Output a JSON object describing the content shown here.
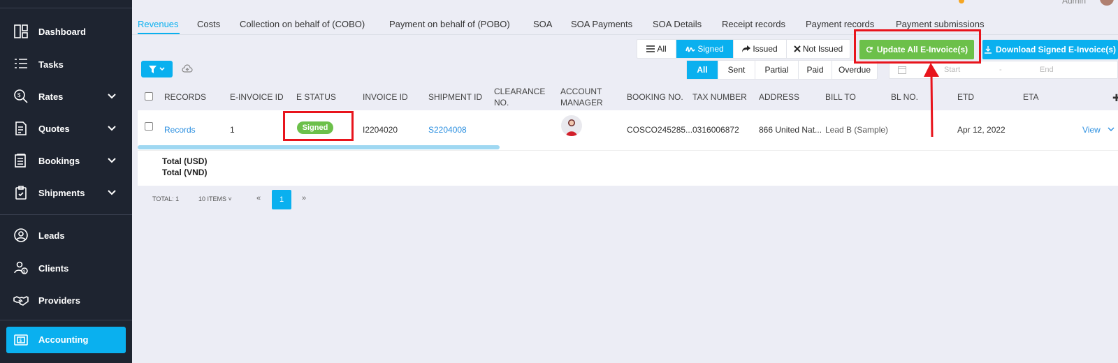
{
  "header": {
    "admin_label": "Admin"
  },
  "sidebar": {
    "items": [
      {
        "label": "Dashboard",
        "icon": "dashboard-icon"
      },
      {
        "label": "Tasks",
        "icon": "tasks-icon"
      },
      {
        "label": "Rates",
        "icon": "rates-icon"
      },
      {
        "label": "Quotes",
        "icon": "quotes-icon"
      },
      {
        "label": "Bookings",
        "icon": "bookings-icon"
      },
      {
        "label": "Shipments",
        "icon": "shipments-icon"
      },
      {
        "label": "Leads",
        "icon": "leads-icon"
      },
      {
        "label": "Clients",
        "icon": "clients-icon"
      },
      {
        "label": "Providers",
        "icon": "providers-icon"
      },
      {
        "label": "Accounting",
        "icon": "accounting-icon"
      }
    ]
  },
  "tabs": [
    "Revenues",
    "Costs",
    "Collection on behalf of (COBO)",
    "Payment on behalf of (POBO)",
    "SOA",
    "SOA Payments",
    "SOA Details",
    "Receipt records",
    "Payment records",
    "Payment submissions"
  ],
  "einvoice_filter": {
    "options": [
      {
        "label": "All",
        "icon": "list-icon"
      },
      {
        "label": "Signed",
        "icon": "signature-icon"
      },
      {
        "label": "Issued",
        "icon": "share-icon"
      },
      {
        "label": "Not Issued",
        "icon": "x-icon"
      }
    ],
    "selected": "Signed"
  },
  "actions": {
    "update_label": "Update All E-Invoice(s)",
    "download_label": "Download Signed E-Invoice(s)"
  },
  "status_filter": {
    "options": [
      "All",
      "Sent",
      "Partial",
      "Paid",
      "Overdue"
    ],
    "selected": "All"
  },
  "date_range": {
    "start_placeholder": "Start",
    "separator": "-",
    "end_placeholder": "End"
  },
  "table": {
    "headers": {
      "records": "RECORDS",
      "einvoice_id": "E-INVOICE ID",
      "e_status": "E STATUS",
      "invoice_id": "INVOICE ID",
      "shipment_id": "SHIPMENT ID",
      "clearance_no_1": "CLEARANCE",
      "clearance_no_2": "NO.",
      "account_manager_1": "ACCOUNT",
      "account_manager_2": "MANAGER",
      "booking_no": "BOOKING NO.",
      "tax_number": "TAX NUMBER",
      "address": "ADDRESS",
      "bill_to": "BILL TO",
      "bl_no": "BL NO.",
      "etd": "ETD",
      "eta": "ETA"
    },
    "rows": [
      {
        "records": "Records",
        "einvoice_id": "1",
        "e_status": "Signed",
        "invoice_id": "I2204020",
        "shipment_id": "S2204008",
        "booking_no": "COSCO245285...",
        "tax_number": "0316006872",
        "address": "866 United Nat...",
        "bill_to": "Lead B (Sample)",
        "etd": "Apr 12, 2022",
        "action": "View"
      }
    ],
    "totals": [
      "Total (USD)",
      "Total (VND)"
    ]
  },
  "pagination": {
    "total": "TOTAL: 1",
    "page_size": "10 ITEMS",
    "prev": "«",
    "current": "1",
    "next": "»"
  },
  "colors": {
    "accent": "#0ab0ef",
    "success": "#6cc04a",
    "sidebar": "#1e2430",
    "annotation": "#e8141c"
  }
}
